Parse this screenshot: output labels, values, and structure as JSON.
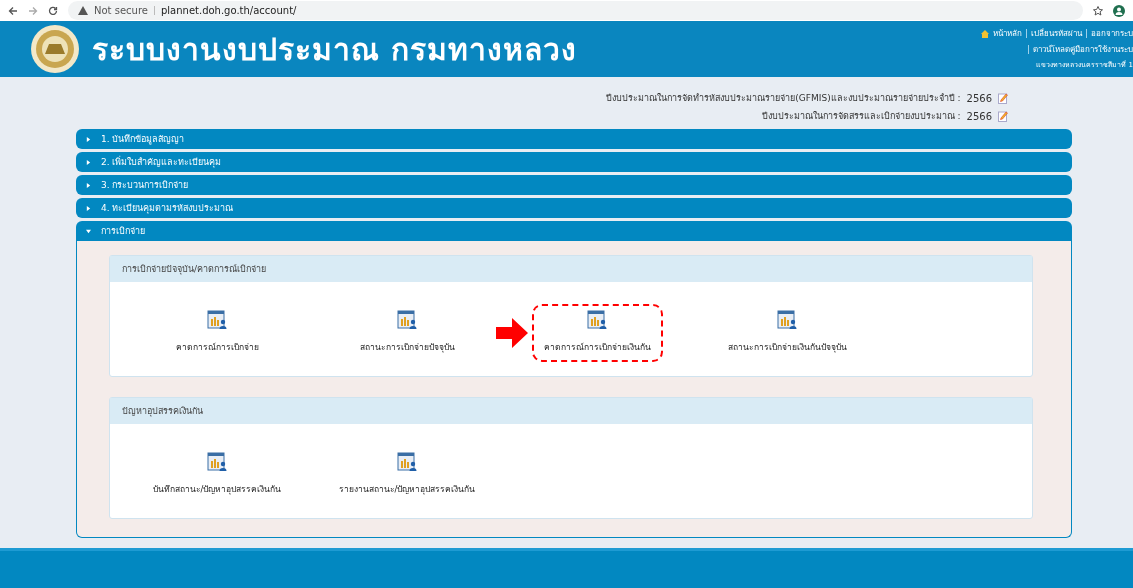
{
  "browser": {
    "security": "Not secure",
    "url": "plannet.doh.go.th/account/"
  },
  "header": {
    "title": "ระบบงานงบประมาณ กรมทางหลวง",
    "links": [
      "หน้าหลัก",
      "เปลี่ยนรหัสผ่าน",
      "ออกจากระบ"
    ],
    "download": "ดาวน์โหลดคู่มือการใช้งานระบ",
    "office": "แขวงทางหลวงนครราชสีมาที่ 1"
  },
  "years": [
    {
      "label": "ปีงบประมาณในการจัดทำรหัสงบประมาณรายจ่าย(GFMIS)และงบประมาณรายจ่ายประจำปี :",
      "value": "2566"
    },
    {
      "label": "ปีงบประมาณในการจัดสรรและเบิกจ่ายงบประมาณ :",
      "value": "2566"
    }
  ],
  "accordion": [
    {
      "label": "1. บันทึกข้อมูลสัญญา",
      "expanded": false
    },
    {
      "label": "2. เพิ่มใบสำคัญและทะเบียนคุม",
      "expanded": false
    },
    {
      "label": "3. กระบวนการเบิกจ่าย",
      "expanded": false
    },
    {
      "label": "4. ทะเบียนคุมตามรหัสงบประมาณ",
      "expanded": false
    },
    {
      "label": "การเบิกจ่าย",
      "expanded": true,
      "sections": [
        {
          "title": "การเบิกจ่ายปัจจุบัน/คาดการณ์เบิกจ่าย",
          "tiles": [
            {
              "label": "คาดการณ์การเบิกจ่าย",
              "highlighted": false
            },
            {
              "label": "สถานะการเบิกจ่ายปัจจุบัน",
              "highlighted": false
            },
            {
              "label": "คาดการณ์การเบิกจ่ายเงินกัน",
              "highlighted": true
            },
            {
              "label": "สถานะการเบิกจ่ายเงินกันปัจจุบัน",
              "highlighted": false
            }
          ]
        },
        {
          "title": "ปัญหาอุปสรรคเงินกัน",
          "tiles": [
            {
              "label": "บันทึกสถานะ/ปัญหาอุปสรรคเงินกัน",
              "highlighted": false
            },
            {
              "label": "รายงานสถานะ/ปัญหาอุปสรรคเงินกัน",
              "highlighted": false
            }
          ]
        }
      ]
    }
  ]
}
